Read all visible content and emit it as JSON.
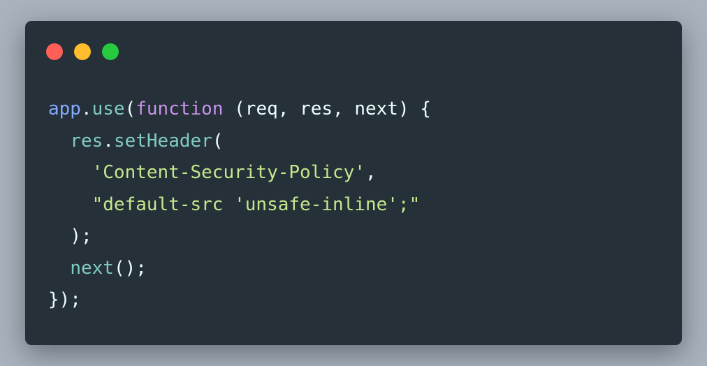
{
  "colors": {
    "close": "#ff5f56",
    "minimize": "#ffbd2e",
    "maximize": "#27c93f"
  },
  "code": {
    "line1": {
      "obj": "app",
      "dot": ".",
      "method": "use",
      "paren": "(",
      "keyword": "function",
      "params": " (req, res, next) {"
    },
    "line2": {
      "indent": "  ",
      "obj": "res",
      "dot": ".",
      "method": "setHeader",
      "paren": "("
    },
    "line3": {
      "indent": "    ",
      "string": "'Content-Security-Policy'",
      "comma": ","
    },
    "line4": {
      "indent": "    ",
      "string": "\"default-src 'unsafe-inline';\""
    },
    "line5": {
      "indent": "  ",
      "close": ");"
    },
    "line6": {
      "indent": "  ",
      "call": "next",
      "args": "();"
    },
    "line7": {
      "close": "});"
    }
  }
}
